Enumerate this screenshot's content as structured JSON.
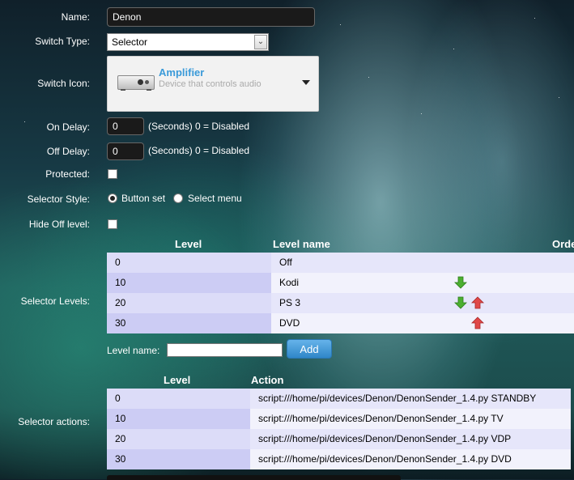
{
  "form": {
    "name": {
      "label": "Name:",
      "value": "Denon"
    },
    "switch_type": {
      "label": "Switch Type:",
      "value": "Selector"
    },
    "switch_icon": {
      "label": "Switch Icon:",
      "title": "Amplifier",
      "description": "Device that controls audio"
    },
    "on_delay": {
      "label": "On Delay:",
      "value": "0",
      "hint": "(Seconds) 0 = Disabled"
    },
    "off_delay": {
      "label": "Off Delay:",
      "value": "0",
      "hint": "(Seconds) 0 = Disabled"
    },
    "protected": {
      "label": "Protected:",
      "checked": false
    },
    "selector_style": {
      "label": "Selector Style:",
      "options": [
        "Button set",
        "Select menu"
      ],
      "selected": "Button set"
    },
    "hide_off_level": {
      "label": "Hide Off level:",
      "checked": false
    }
  },
  "selector_levels": {
    "label": "Selector Levels:",
    "headers": {
      "level": "Level",
      "level_name": "Level name",
      "order": "Order"
    },
    "rows": [
      {
        "level": "0",
        "name": "Off",
        "down": false,
        "up": false
      },
      {
        "level": "10",
        "name": "Kodi",
        "down": true,
        "up": false
      },
      {
        "level": "20",
        "name": "PS 3",
        "down": true,
        "up": true
      },
      {
        "level": "30",
        "name": "DVD",
        "down": false,
        "up": true
      }
    ],
    "add_label": "Level name:",
    "add_value": "",
    "add_button": "Add"
  },
  "selector_actions": {
    "label": "Selector actions:",
    "headers": {
      "level": "Level",
      "action": "Action"
    },
    "rows": [
      {
        "level": "0",
        "action": "script:///home/pi/devices/Denon/DenonSender_1.4.py STANDBY"
      },
      {
        "level": "10",
        "action": "script:///home/pi/devices/Denon/DenonSender_1.4.py TV"
      },
      {
        "level": "20",
        "action": "script:///home/pi/devices/Denon/DenonSender_1.4.py VDP"
      },
      {
        "level": "30",
        "action": "script:///home/pi/devices/Denon/DenonSender_1.4.py DVD"
      }
    ]
  },
  "colors": {
    "row_level_a": "#ccccf4",
    "row_level_b": "#dcdcf8",
    "row_name_a": "#e6e6fa",
    "row_name_b": "#f2f2fc",
    "arrow_down": "#4caf30",
    "arrow_up": "#e04848",
    "accent": "#3a9ad9"
  }
}
